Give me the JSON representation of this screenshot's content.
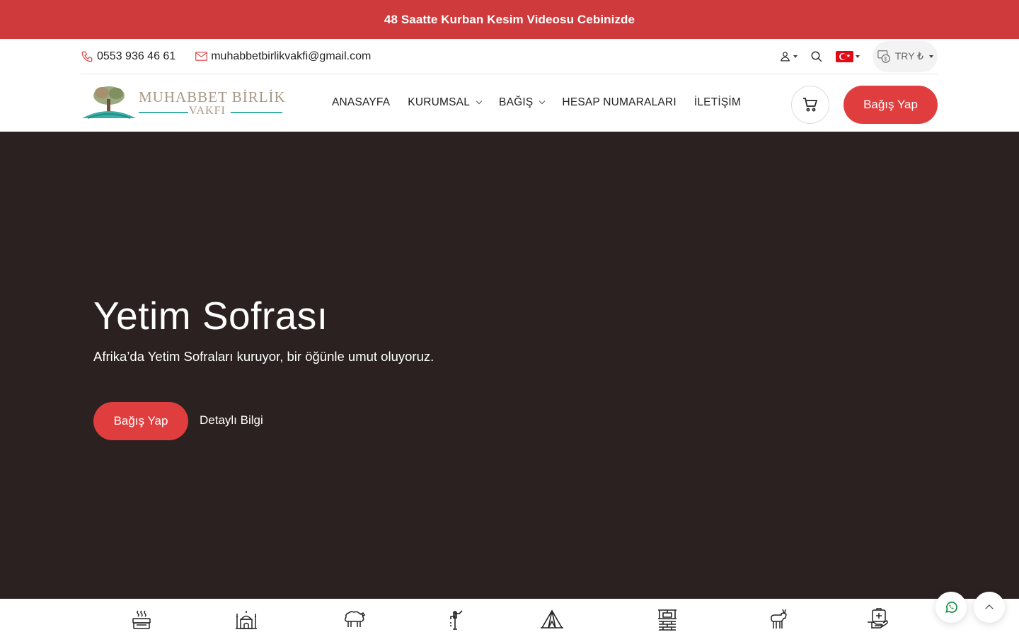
{
  "announcement": {
    "text": "48 Saatte Kurban Kesim Videosu Cebinizde"
  },
  "topbar": {
    "phone": "0553 936 46 61",
    "email": "muhabbetbirlikvakfi@gmail.com",
    "currency": "TRY ₺",
    "icons": [
      "user-icon",
      "search-icon",
      "turkey-flag-icon",
      "currency-icon"
    ]
  },
  "logo": {
    "line1": "MUHABBET BİRLİK",
    "line2": "VAKFI"
  },
  "nav": {
    "items": [
      {
        "label": "ANASAYFA",
        "dropdown": false
      },
      {
        "label": "KURUMSAL",
        "dropdown": true
      },
      {
        "label": "BAĞIŞ",
        "dropdown": true
      },
      {
        "label": "HESAP NUMARALARI",
        "dropdown": false
      },
      {
        "label": "İLETİŞİM",
        "dropdown": false
      }
    ],
    "donate_label": "Bağış Yap"
  },
  "hero": {
    "title": "Yetim Sofrası",
    "subtitle": "Afrika’da Yetim Sofraları kuruyor, bir öğünle umut oluyoruz.",
    "donate_label": "Bağış Yap",
    "info_label": "Detaylı Bilgi"
  },
  "categories": [
    "food-box-icon",
    "mosque-icon",
    "sheep-icon",
    "water-pump-icon",
    "tent-icon",
    "well-icon",
    "goat-icon",
    "health-aid-icon"
  ],
  "colors": {
    "accent": "#e03e3e",
    "announce_bg": "#cf3b3c",
    "hero_bg": "#2b2120",
    "logo_teal": "#3aaea4"
  }
}
